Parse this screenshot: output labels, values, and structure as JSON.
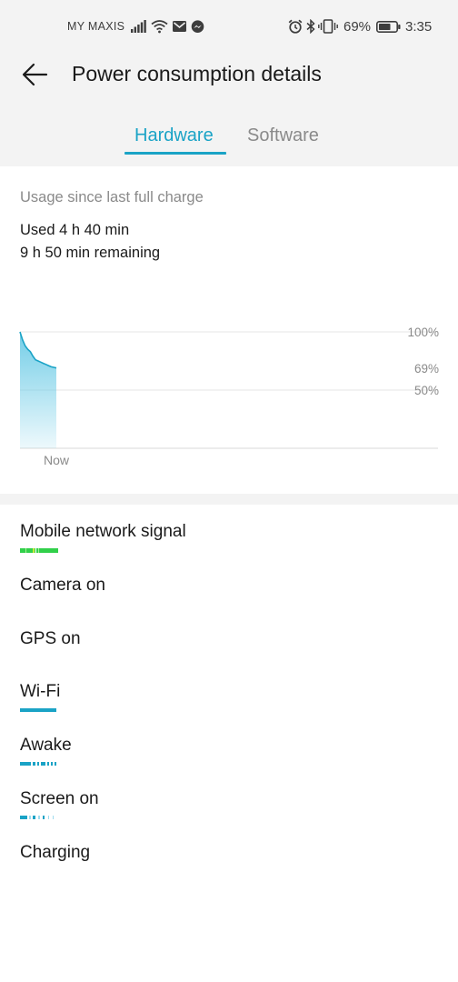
{
  "status_bar": {
    "carrier": "MY MAXIS",
    "battery_percent": "69%",
    "time": "3:35"
  },
  "header": {
    "title": "Power consumption details"
  },
  "tabs": [
    {
      "label": "Hardware",
      "active": true
    },
    {
      "label": "Software",
      "active": false
    }
  ],
  "usage": {
    "label": "Usage since last full charge",
    "used": "Used 4 h 40 min",
    "remaining": "9 h 50 min remaining"
  },
  "chart_data": {
    "type": "area",
    "y_unit": "%",
    "ylim": [
      0,
      100
    ],
    "y_ticks": [
      "100%",
      "69%",
      "50%"
    ],
    "x_label": "Now",
    "values": [
      100,
      93,
      88,
      85,
      83,
      79,
      76,
      75,
      74,
      73,
      72,
      71,
      70,
      69.5,
      69
    ],
    "current_level": 69,
    "color": "#6ccbe6"
  },
  "hardware_items": [
    {
      "label": "Mobile network signal",
      "color": "#31d04a"
    },
    {
      "label": "Camera on"
    },
    {
      "label": "GPS on"
    },
    {
      "label": "Wi-Fi",
      "color": "#1aa3c6"
    },
    {
      "label": "Awake",
      "color": "#1aa3c6"
    },
    {
      "label": "Screen on",
      "color": "#1aa3c6"
    },
    {
      "label": "Charging"
    }
  ],
  "colors": {
    "accent": "#1aa3c6",
    "header_bg": "#f3f3f3",
    "signal_green": "#31d04a"
  }
}
